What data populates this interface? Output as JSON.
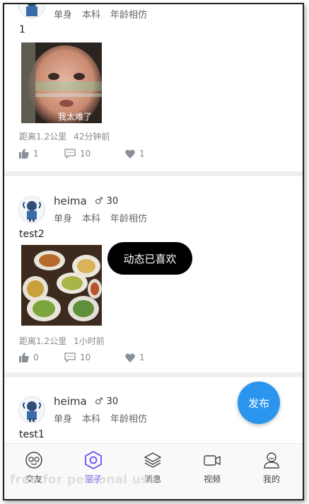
{
  "feed": {
    "posts": [
      {
        "tags": [
          "单身",
          "本科",
          "年龄相仿"
        ],
        "text": "1",
        "image_caption": "我太难了",
        "distance": "距离1.2公里",
        "time": "42分钟前",
        "likes": "1",
        "comments": "10",
        "loves": "1"
      },
      {
        "username": "heima",
        "gender_symbol": "♂",
        "age": "30",
        "tags": [
          "单身",
          "本科",
          "年龄相仿"
        ],
        "text": "test2",
        "distance": "距离1.2公里",
        "time": "1小时前",
        "likes": "0",
        "comments": "10",
        "loves": "1"
      },
      {
        "username": "heima",
        "gender_symbol": "♂",
        "age": "30",
        "tags": [
          "单身",
          "本科",
          "年龄相仿"
        ],
        "text": "test1"
      }
    ]
  },
  "toast": {
    "message": "动态已喜欢"
  },
  "fab": {
    "label": "发布"
  },
  "tabbar": {
    "items": [
      {
        "label": "交友",
        "icon": "chat-bubble-icon"
      },
      {
        "label": "圈子",
        "icon": "hexagon-circle-icon",
        "active": true
      },
      {
        "label": "消息",
        "icon": "layers-icon"
      },
      {
        "label": "视频",
        "icon": "video-camera-icon"
      },
      {
        "label": "我的",
        "icon": "user-profile-icon"
      }
    ]
  },
  "watermark": {
    "text": "free for personal use"
  },
  "colors": {
    "accent": "#2b95ee",
    "active_tab": "#6b4cf5",
    "toast_bg": "#000000"
  }
}
